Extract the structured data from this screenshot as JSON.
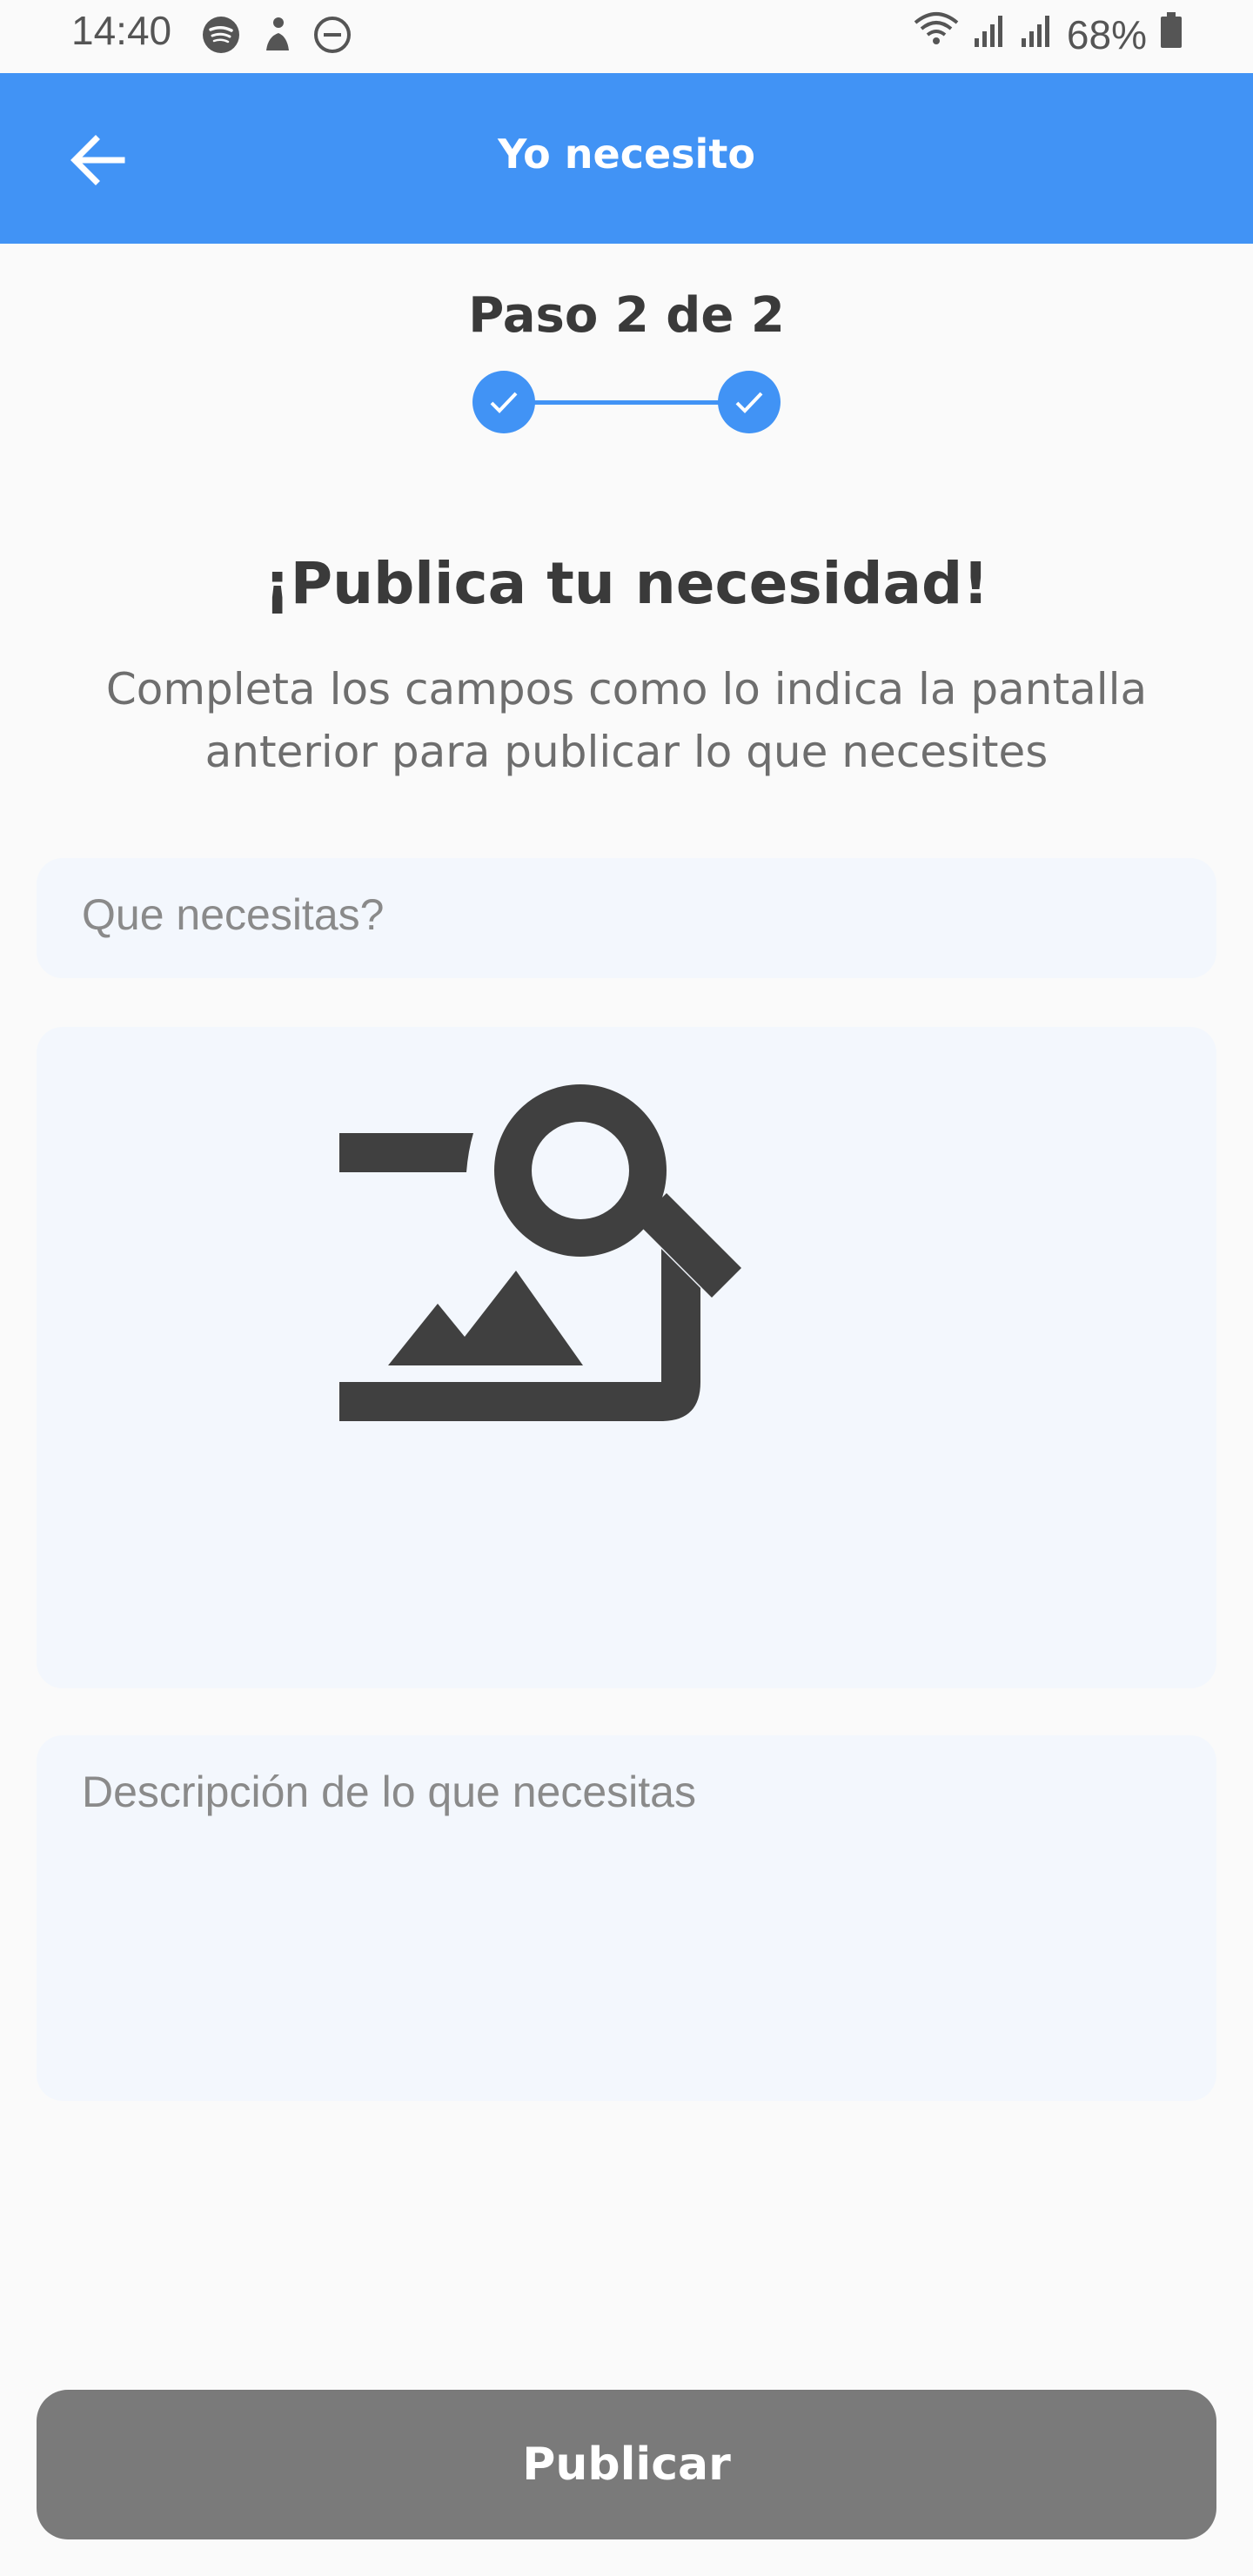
{
  "status_bar": {
    "time": "14:40",
    "battery": "68%",
    "icons": [
      "spotify-icon",
      "fitness-icon",
      "do-not-disturb-icon",
      "wifi-icon",
      "signal-icon",
      "signal-icon",
      "battery-icon"
    ]
  },
  "app_bar": {
    "title": "Yo necesito",
    "back_icon": "arrow-left-icon",
    "background_color": "#4193f5"
  },
  "stepper": {
    "label": "Paso 2 de 2",
    "steps_completed": 2,
    "steps_total": 2
  },
  "content": {
    "headline": "¡Publica tu necesidad!",
    "subtitle": "Completa los campos como lo indica la pantalla anterior para publicar lo que necesites"
  },
  "form": {
    "title_placeholder": "Que necesitas?",
    "title_value": "",
    "image_icon": "image-search-icon",
    "description_placeholder": "Descripción de lo que necesitas",
    "description_value": ""
  },
  "actions": {
    "publish_label": "Publicar",
    "publish_color": "#7a7a7a"
  }
}
